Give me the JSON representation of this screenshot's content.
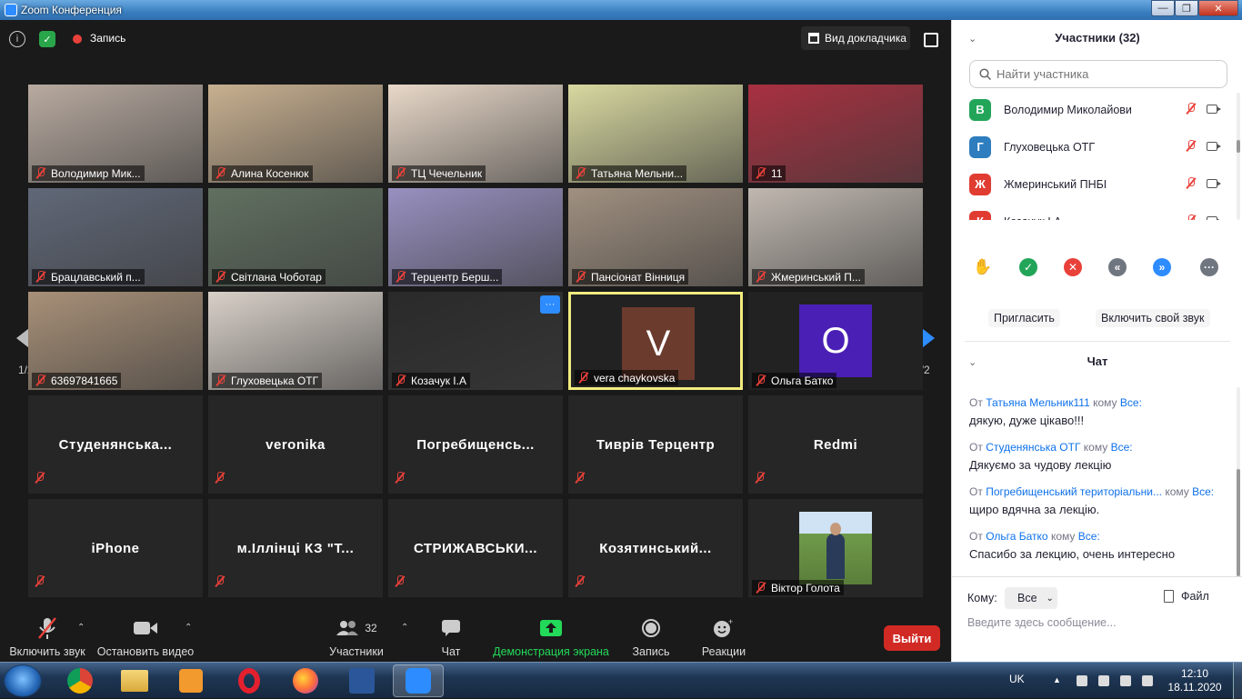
{
  "window": {
    "title": "Zoom Конференция",
    "min": "—",
    "max": "❐",
    "close": "✕"
  },
  "topbar": {
    "recording_label": "Запись",
    "speaker_view_label": "Вид докладчика"
  },
  "gallery": {
    "page_left": "1/2",
    "page_right": "1/2",
    "video_tiles": [
      {
        "name": "Володимир Мик...",
        "bg": "#b8aaa0"
      },
      {
        "name": "Алина Косенюк",
        "bg": "#c8b090"
      },
      {
        "name": "ТЦ Чечельник",
        "bg": "#e8d8c8"
      },
      {
        "name": "Татьяна Мельни...",
        "bg": "#d8d8a0"
      },
      {
        "name": "11",
        "bg": "#a83040"
      },
      {
        "name": "Брацлавський п...",
        "bg": "#606878"
      },
      {
        "name": "Світлана Чоботар",
        "bg": "#607060"
      },
      {
        "name": "Терцентр Берш...",
        "bg": "#9890c0"
      },
      {
        "name": "Пансіонат Вінниця",
        "bg": "#a09080"
      },
      {
        "name": "Жмеринський П...",
        "bg": "#c0b8b0"
      },
      {
        "name": "63697841665",
        "bg": "#a89078"
      },
      {
        "name": "Глуховецька ОТГ",
        "bg": "#d8d0c8"
      },
      {
        "name": "Козачук І.А",
        "bg": "#2a2a2a"
      },
      {
        "name": "vera chaykovska",
        "bg": "#222222",
        "avatar": "V",
        "avatar_color": "#6b3b2e"
      },
      {
        "name": "Ольга Батко",
        "bg": "#222222",
        "avatar": "O",
        "avatar_color": "#4a1fb5"
      }
    ],
    "name_tiles": [
      "Студенянська...",
      "veronika",
      "Погребищенсь...",
      "Тиврів Терцентр",
      "Redmi",
      "iPhone",
      "м.Іллінці КЗ  \"Т...",
      "СТРИЖАВСЬКИ...",
      "Козятинський..."
    ],
    "photo_tile": {
      "name": "Віктор Голота"
    }
  },
  "bottombar": {
    "unmute": "Включить звук",
    "stop_video": "Остановить видео",
    "participants_label": "Участники",
    "participants_count": "32",
    "chat": "Чат",
    "share_screen": "Демонстрация экрана",
    "record": "Запись",
    "reactions": "Реакции",
    "leave": "Выйти",
    "share_color": "#23d959"
  },
  "participants_panel": {
    "title": "Участники (32)",
    "search_placeholder": "Найти участника",
    "list": [
      {
        "initial": "В",
        "name": "Володимир Миколайови",
        "color": "#23a559"
      },
      {
        "initial": "Г",
        "name": "Глуховецька ОТГ",
        "color": "#2d7dbf"
      },
      {
        "initial": "Ж",
        "name": "Жмеринський ПНБІ",
        "color": "#e03c31"
      },
      {
        "initial": "К",
        "name": "Козачук І.А",
        "color": "#e03c31"
      }
    ],
    "invite": "Пригласить",
    "unmute_self": "Включить свой звук"
  },
  "chat": {
    "title": "Чат",
    "messages": [
      {
        "from_word": "От",
        "sender": "Татьяна Мельник111",
        "to_word": "кому",
        "recipient": "Все:",
        "text": "дякую, дуже цікаво!!!"
      },
      {
        "from_word": "От",
        "sender": "Студенянська ОТГ",
        "to_word": "кому",
        "recipient": "Все:",
        "text": "Дякуємо за чудову лекцію"
      },
      {
        "from_word": "От",
        "sender": "Погребищенський територіальни...",
        "to_word": "кому",
        "recipient": "Все:",
        "text": "щиро вдячна за лекцію."
      },
      {
        "from_word": "От",
        "sender": "Ольга Батко",
        "to_word": "кому",
        "recipient": "Все:",
        "text": "Спасибо за лекцию, очень интересно"
      }
    ],
    "to_label": "Кому:",
    "to_value": "Все",
    "file_label": "Файл",
    "input_placeholder": "Введите здесь сообщение..."
  },
  "taskbar": {
    "lang": "UK",
    "time": "12:10",
    "date": "18.11.2020"
  }
}
